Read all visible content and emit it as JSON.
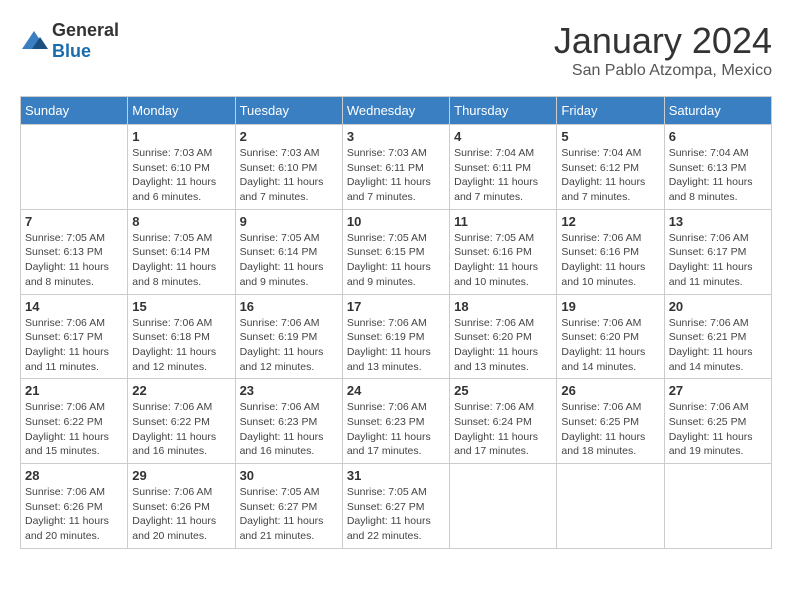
{
  "logo": {
    "text_general": "General",
    "text_blue": "Blue"
  },
  "header": {
    "month": "January 2024",
    "location": "San Pablo Atzompa, Mexico"
  },
  "weekdays": [
    "Sunday",
    "Monday",
    "Tuesday",
    "Wednesday",
    "Thursday",
    "Friday",
    "Saturday"
  ],
  "weeks": [
    [
      {
        "day": "",
        "info": ""
      },
      {
        "day": "1",
        "info": "Sunrise: 7:03 AM\nSunset: 6:10 PM\nDaylight: 11 hours\nand 6 minutes."
      },
      {
        "day": "2",
        "info": "Sunrise: 7:03 AM\nSunset: 6:10 PM\nDaylight: 11 hours\nand 7 minutes."
      },
      {
        "day": "3",
        "info": "Sunrise: 7:03 AM\nSunset: 6:11 PM\nDaylight: 11 hours\nand 7 minutes."
      },
      {
        "day": "4",
        "info": "Sunrise: 7:04 AM\nSunset: 6:11 PM\nDaylight: 11 hours\nand 7 minutes."
      },
      {
        "day": "5",
        "info": "Sunrise: 7:04 AM\nSunset: 6:12 PM\nDaylight: 11 hours\nand 7 minutes."
      },
      {
        "day": "6",
        "info": "Sunrise: 7:04 AM\nSunset: 6:13 PM\nDaylight: 11 hours\nand 8 minutes."
      }
    ],
    [
      {
        "day": "7",
        "info": "Sunrise: 7:05 AM\nSunset: 6:13 PM\nDaylight: 11 hours\nand 8 minutes."
      },
      {
        "day": "8",
        "info": "Sunrise: 7:05 AM\nSunset: 6:14 PM\nDaylight: 11 hours\nand 8 minutes."
      },
      {
        "day": "9",
        "info": "Sunrise: 7:05 AM\nSunset: 6:14 PM\nDaylight: 11 hours\nand 9 minutes."
      },
      {
        "day": "10",
        "info": "Sunrise: 7:05 AM\nSunset: 6:15 PM\nDaylight: 11 hours\nand 9 minutes."
      },
      {
        "day": "11",
        "info": "Sunrise: 7:05 AM\nSunset: 6:16 PM\nDaylight: 11 hours\nand 10 minutes."
      },
      {
        "day": "12",
        "info": "Sunrise: 7:06 AM\nSunset: 6:16 PM\nDaylight: 11 hours\nand 10 minutes."
      },
      {
        "day": "13",
        "info": "Sunrise: 7:06 AM\nSunset: 6:17 PM\nDaylight: 11 hours\nand 11 minutes."
      }
    ],
    [
      {
        "day": "14",
        "info": "Sunrise: 7:06 AM\nSunset: 6:17 PM\nDaylight: 11 hours\nand 11 minutes."
      },
      {
        "day": "15",
        "info": "Sunrise: 7:06 AM\nSunset: 6:18 PM\nDaylight: 11 hours\nand 12 minutes."
      },
      {
        "day": "16",
        "info": "Sunrise: 7:06 AM\nSunset: 6:19 PM\nDaylight: 11 hours\nand 12 minutes."
      },
      {
        "day": "17",
        "info": "Sunrise: 7:06 AM\nSunset: 6:19 PM\nDaylight: 11 hours\nand 13 minutes."
      },
      {
        "day": "18",
        "info": "Sunrise: 7:06 AM\nSunset: 6:20 PM\nDaylight: 11 hours\nand 13 minutes."
      },
      {
        "day": "19",
        "info": "Sunrise: 7:06 AM\nSunset: 6:20 PM\nDaylight: 11 hours\nand 14 minutes."
      },
      {
        "day": "20",
        "info": "Sunrise: 7:06 AM\nSunset: 6:21 PM\nDaylight: 11 hours\nand 14 minutes."
      }
    ],
    [
      {
        "day": "21",
        "info": "Sunrise: 7:06 AM\nSunset: 6:22 PM\nDaylight: 11 hours\nand 15 minutes."
      },
      {
        "day": "22",
        "info": "Sunrise: 7:06 AM\nSunset: 6:22 PM\nDaylight: 11 hours\nand 16 minutes."
      },
      {
        "day": "23",
        "info": "Sunrise: 7:06 AM\nSunset: 6:23 PM\nDaylight: 11 hours\nand 16 minutes."
      },
      {
        "day": "24",
        "info": "Sunrise: 7:06 AM\nSunset: 6:23 PM\nDaylight: 11 hours\nand 17 minutes."
      },
      {
        "day": "25",
        "info": "Sunrise: 7:06 AM\nSunset: 6:24 PM\nDaylight: 11 hours\nand 17 minutes."
      },
      {
        "day": "26",
        "info": "Sunrise: 7:06 AM\nSunset: 6:25 PM\nDaylight: 11 hours\nand 18 minutes."
      },
      {
        "day": "27",
        "info": "Sunrise: 7:06 AM\nSunset: 6:25 PM\nDaylight: 11 hours\nand 19 minutes."
      }
    ],
    [
      {
        "day": "28",
        "info": "Sunrise: 7:06 AM\nSunset: 6:26 PM\nDaylight: 11 hours\nand 20 minutes."
      },
      {
        "day": "29",
        "info": "Sunrise: 7:06 AM\nSunset: 6:26 PM\nDaylight: 11 hours\nand 20 minutes."
      },
      {
        "day": "30",
        "info": "Sunrise: 7:05 AM\nSunset: 6:27 PM\nDaylight: 11 hours\nand 21 minutes."
      },
      {
        "day": "31",
        "info": "Sunrise: 7:05 AM\nSunset: 6:27 PM\nDaylight: 11 hours\nand 22 minutes."
      },
      {
        "day": "",
        "info": ""
      },
      {
        "day": "",
        "info": ""
      },
      {
        "day": "",
        "info": ""
      }
    ]
  ]
}
